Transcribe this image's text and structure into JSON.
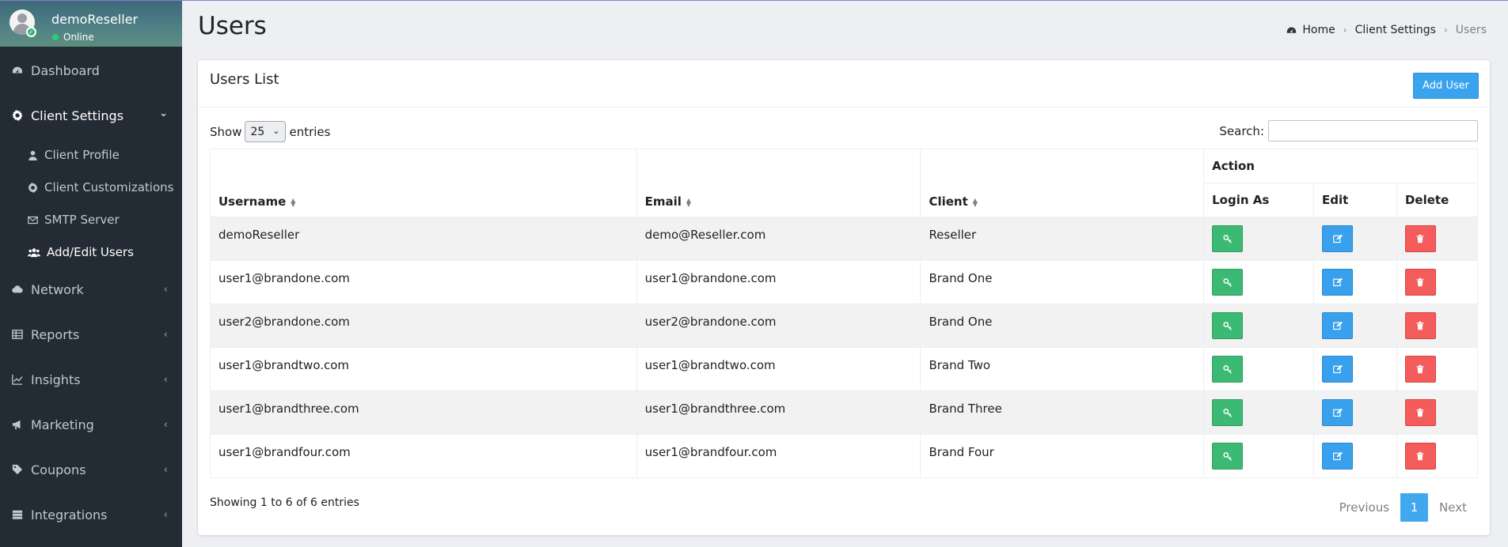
{
  "user_panel": {
    "name": "demoReseller",
    "status": "Online"
  },
  "nav": {
    "dashboard": "Dashboard",
    "client_settings": "Client Settings",
    "client_settings_chevron": "⌄",
    "sub": {
      "client_profile": "Client Profile",
      "client_customizations": "Client Customizations",
      "smtp_server": "SMTP Server",
      "add_edit_users": "Add/Edit Users"
    },
    "network": "Network",
    "reports": "Reports",
    "insights": "Insights",
    "marketing": "Marketing",
    "coupons": "Coupons",
    "integrations": "Integrations",
    "collapsed_chevron": "‹"
  },
  "page": {
    "title": "Users"
  },
  "breadcrumb": {
    "home": "Home",
    "sep": "›",
    "client_settings": "Client Settings",
    "current": "Users"
  },
  "card": {
    "title": "Users List",
    "add_user": "Add User"
  },
  "table_controls": {
    "show": "Show",
    "entries_value": "25",
    "entries": "entries",
    "search_label": "Search:",
    "search_value": ""
  },
  "table": {
    "headers": {
      "username": "Username",
      "email": "Email",
      "client": "Client",
      "action": "Action",
      "login_as": "Login As",
      "edit": "Edit",
      "delete": "Delete"
    },
    "rows": [
      {
        "username": "demoReseller",
        "email": "demo@Reseller.com",
        "client": "Reseller"
      },
      {
        "username": "user1@brandone.com",
        "email": "user1@brandone.com",
        "client": "Brand One"
      },
      {
        "username": "user2@brandone.com",
        "email": "user2@brandone.com",
        "client": "Brand One"
      },
      {
        "username": "user1@brandtwo.com",
        "email": "user1@brandtwo.com",
        "client": "Brand Two"
      },
      {
        "username": "user1@brandthree.com",
        "email": "user1@brandthree.com",
        "client": "Brand Three"
      },
      {
        "username": "user1@brandfour.com",
        "email": "user1@brandfour.com",
        "client": "Brand Four"
      }
    ]
  },
  "footer": {
    "info": "Showing 1 to 6 of 6 entries",
    "previous": "Previous",
    "page": "1",
    "next": "Next"
  },
  "colors": {
    "sidebar": "#232b34",
    "primary": "#3aa3ee",
    "success": "#3cba74",
    "danger": "#f45b5b"
  },
  "icons": [
    "tachometer-icon",
    "gear-icon",
    "user-icon",
    "envelope-icon",
    "users-icon",
    "cloud-icon",
    "table-icon",
    "line-chart-icon",
    "bullhorn-icon",
    "tag-icon",
    "server-icon",
    "key-icon",
    "edit-icon",
    "trash-icon"
  ]
}
